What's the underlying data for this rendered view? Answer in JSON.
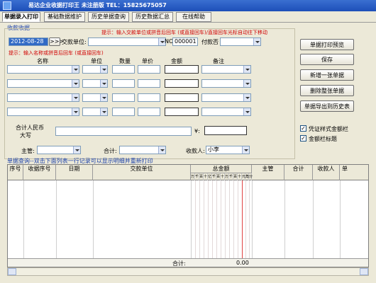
{
  "window": {
    "title": "易达企业收据打印王 未注册版   TEL：15825675057"
  },
  "tabs": [
    {
      "label": "单据录入打印"
    },
    {
      "label": "基础数据维护"
    },
    {
      "label": "历史单据查询"
    },
    {
      "label": "历史数据汇总"
    },
    {
      "label": "在线帮助"
    }
  ],
  "receipt": {
    "section_title": "收款收据",
    "date_value": "2012-08-28",
    "nav_label": ">>>",
    "payer_label": "交款单位:",
    "payer_hint": "提示：输入交款单位或拼音后回车 (或直接回车)/直接回车光标自动往下移动",
    "no_label": "NO.",
    "no_value": "000001",
    "payment_method_label": "付款否",
    "items_hint": "提示：输入名称或拼音后回车 (或直接回车)",
    "columns": {
      "name": "名称",
      "unit": "单位",
      "quantity": "数量",
      "price": "单价",
      "amount": "金额",
      "remark": "备注"
    },
    "total_rmb_label_line1": "合计人民币",
    "total_rmb_label_line2": "大写",
    "yen_label": "¥:",
    "supervisor_label": "主管:",
    "total_label": "合计:",
    "payee_label": "收款人:",
    "payee_value": "小李"
  },
  "buttons": {
    "print_preview": "单据打印预览",
    "save": "保存",
    "new": "新增一张单据",
    "delete": "删除整张单据",
    "export_history": "单据导出到历史表"
  },
  "options": {
    "voucher_style": {
      "label": "凭证样式金额栏",
      "checked": true
    },
    "amount_title": {
      "label": "金额栏标题",
      "checked": true
    }
  },
  "query": {
    "title": "单据查询--双击下面列表一行记录可以显示明细并重新打印",
    "columns": {
      "seq": "序号",
      "receipt_no": "收据序号",
      "date": "日期",
      "payer": "交款单位",
      "total_amount": "总金额",
      "supervisor": "主管",
      "total": "合计",
      "payee": "收款人",
      "tail": "单"
    },
    "amount_units": [
      "万",
      "千",
      "百",
      "十",
      "亿",
      "千",
      "百",
      "十",
      "万",
      "千",
      "百",
      "十",
      "元",
      "角",
      "分"
    ],
    "footer_label": "合计:",
    "footer_value": "0.00"
  },
  "colors": {
    "title_bar": "#1d4fb8",
    "hint_red": "#d00000",
    "section_blue": "#1a3fa8",
    "selection": "#316ac5",
    "window_bg": "#ece9d8"
  }
}
